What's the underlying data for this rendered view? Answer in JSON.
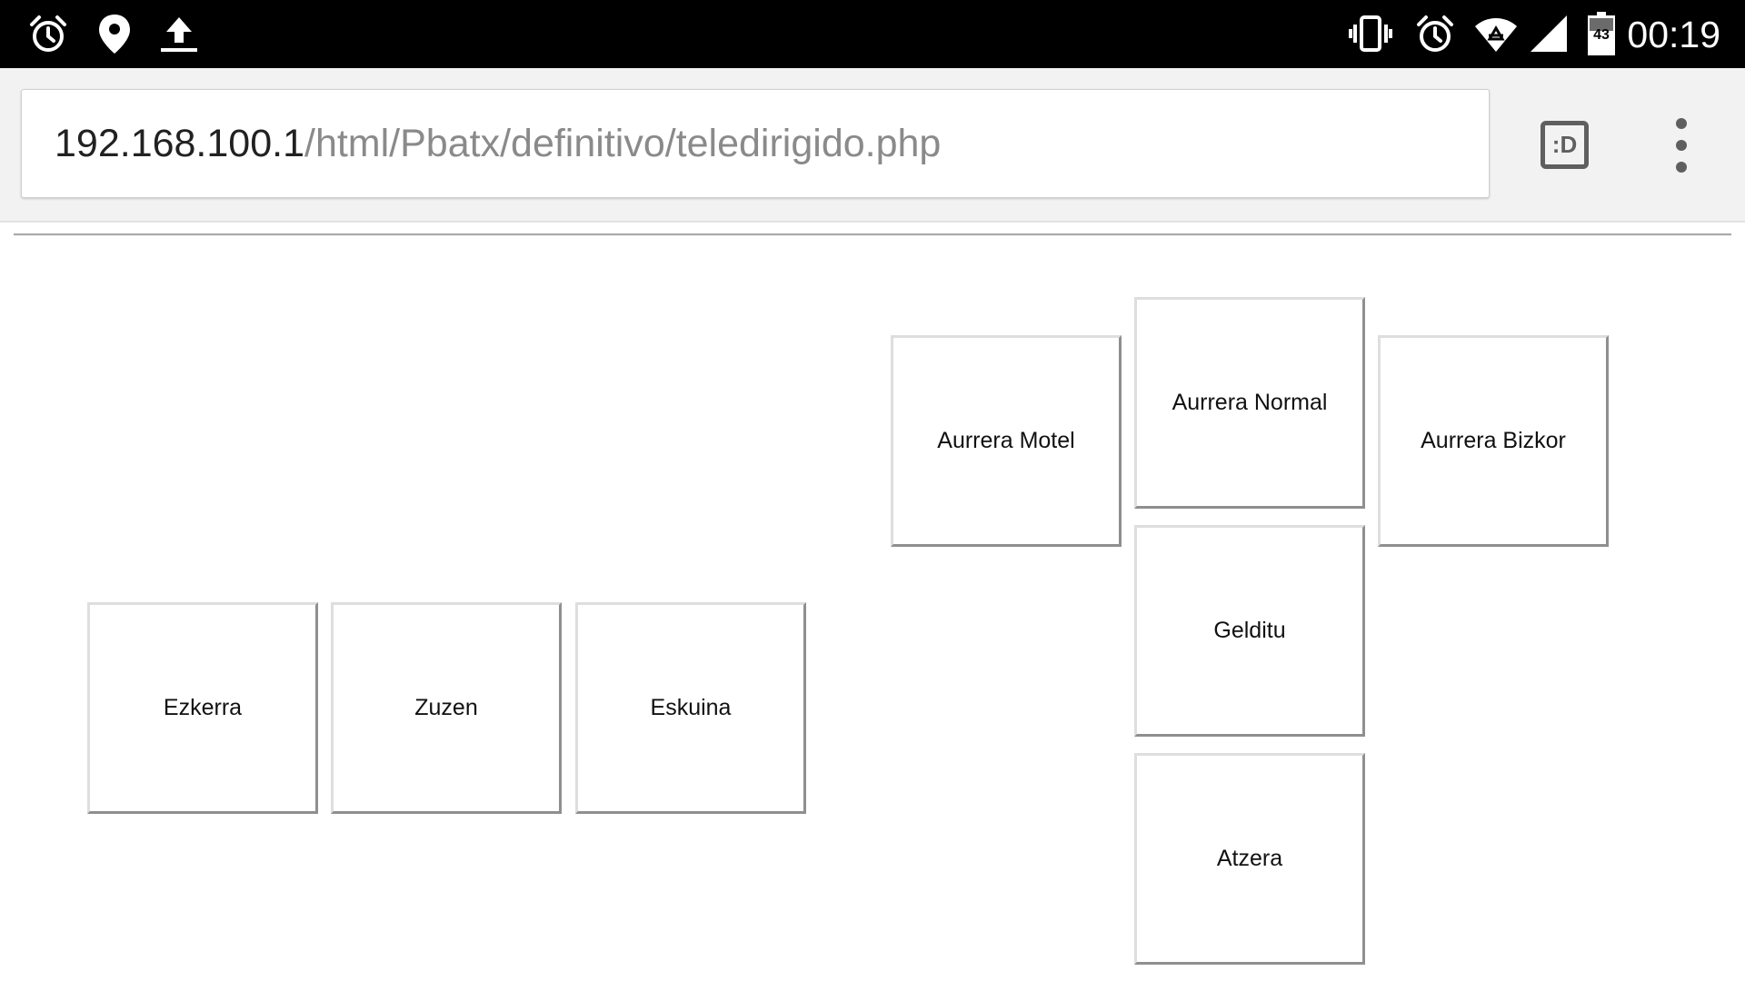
{
  "status_bar": {
    "time": "00:19",
    "battery_level": "43",
    "left_icons": [
      "alarm-icon",
      "location-pin-icon",
      "upload-icon"
    ],
    "right_icons": [
      "vibrate-icon",
      "alarm-icon",
      "wifi-icon",
      "cell-signal-icon",
      "battery-icon"
    ]
  },
  "browser": {
    "url_host": "192.168.100.1",
    "url_path": "/html/Pbatx/definitivo/teledirigido.php",
    "tab_label": ":D",
    "menu_icon": "overflow-menu-icon"
  },
  "controls": {
    "ezkerra": "Ezkerra",
    "zuzen": "Zuzen",
    "eskuina": "Eskuina",
    "aurrera_motel": "Aurrera Motel",
    "aurrera_normal": "Aurrera Normal",
    "aurrera_bizkor": "Aurrera Bizkor",
    "gelditu": "Gelditu",
    "atzera": "Atzera"
  },
  "colors": {
    "status_bar_bg": "#000000",
    "toolbar_bg": "#f2f2f2",
    "url_host": "#212121",
    "url_path": "#8a8a8a",
    "button_border_light": "#dedede",
    "button_border_dark": "#8f8f8f"
  }
}
